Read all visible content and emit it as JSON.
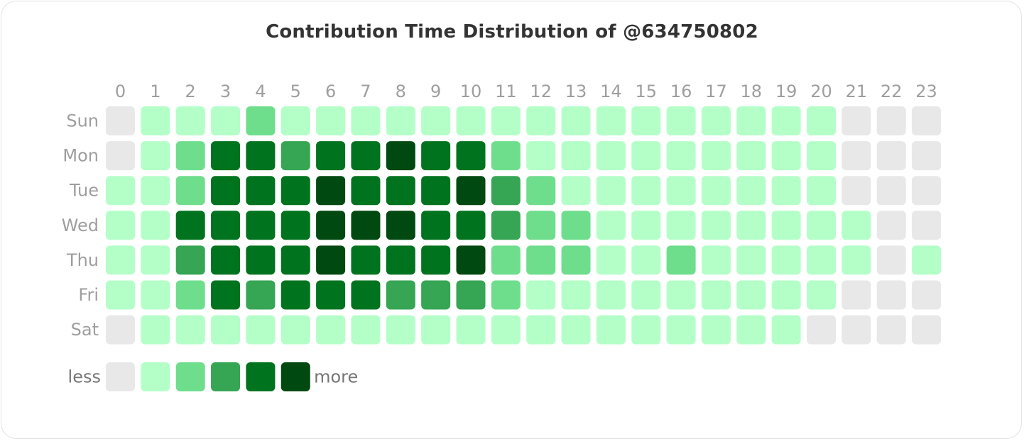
{
  "chart_data": {
    "type": "heatmap",
    "title": "Contribution Time Distribution of @634750802",
    "xlabel": "",
    "ylabel": "",
    "x": [
      "0",
      "1",
      "2",
      "3",
      "4",
      "5",
      "6",
      "7",
      "8",
      "9",
      "10",
      "11",
      "12",
      "13",
      "14",
      "15",
      "16",
      "17",
      "18",
      "19",
      "20",
      "21",
      "22",
      "23"
    ],
    "y": [
      "Sun",
      "Mon",
      "Tue",
      "Wed",
      "Thu",
      "Fri",
      "Sat"
    ],
    "value_scale": "levels 0 (none) to 5 (most)",
    "values": [
      [
        0,
        1,
        1,
        1,
        2,
        1,
        1,
        1,
        1,
        1,
        1,
        1,
        1,
        1,
        1,
        1,
        1,
        1,
        1,
        1,
        1,
        0,
        0,
        0
      ],
      [
        0,
        1,
        2,
        4,
        4,
        3,
        4,
        4,
        5,
        4,
        4,
        2,
        1,
        1,
        1,
        1,
        1,
        1,
        1,
        1,
        1,
        0,
        0,
        0
      ],
      [
        1,
        1,
        2,
        4,
        4,
        4,
        5,
        4,
        4,
        4,
        5,
        3,
        2,
        1,
        1,
        1,
        1,
        1,
        1,
        1,
        1,
        0,
        0,
        0
      ],
      [
        1,
        1,
        4,
        4,
        4,
        4,
        5,
        5,
        5,
        4,
        4,
        3,
        2,
        2,
        1,
        1,
        1,
        1,
        1,
        1,
        1,
        1,
        0,
        0
      ],
      [
        1,
        1,
        3,
        4,
        4,
        4,
        5,
        4,
        4,
        4,
        5,
        2,
        2,
        2,
        1,
        1,
        2,
        1,
        1,
        1,
        1,
        1,
        0,
        1
      ],
      [
        1,
        1,
        2,
        4,
        3,
        4,
        4,
        4,
        3,
        3,
        3,
        2,
        1,
        1,
        1,
        1,
        1,
        1,
        1,
        1,
        1,
        0,
        0,
        0
      ],
      [
        0,
        1,
        1,
        1,
        1,
        1,
        1,
        1,
        1,
        1,
        1,
        1,
        1,
        1,
        1,
        1,
        1,
        1,
        1,
        1,
        0,
        0,
        0,
        0
      ]
    ],
    "legend": {
      "low_label": "less",
      "high_label": "more",
      "levels": [
        0,
        1,
        2,
        3,
        4,
        5
      ],
      "placement": "bottom-left"
    },
    "colors": [
      "#e8e8e8",
      "#b4ffc8",
      "#6ede8d",
      "#36a554",
      "#00731f",
      "#004910"
    ],
    "grid": false
  }
}
